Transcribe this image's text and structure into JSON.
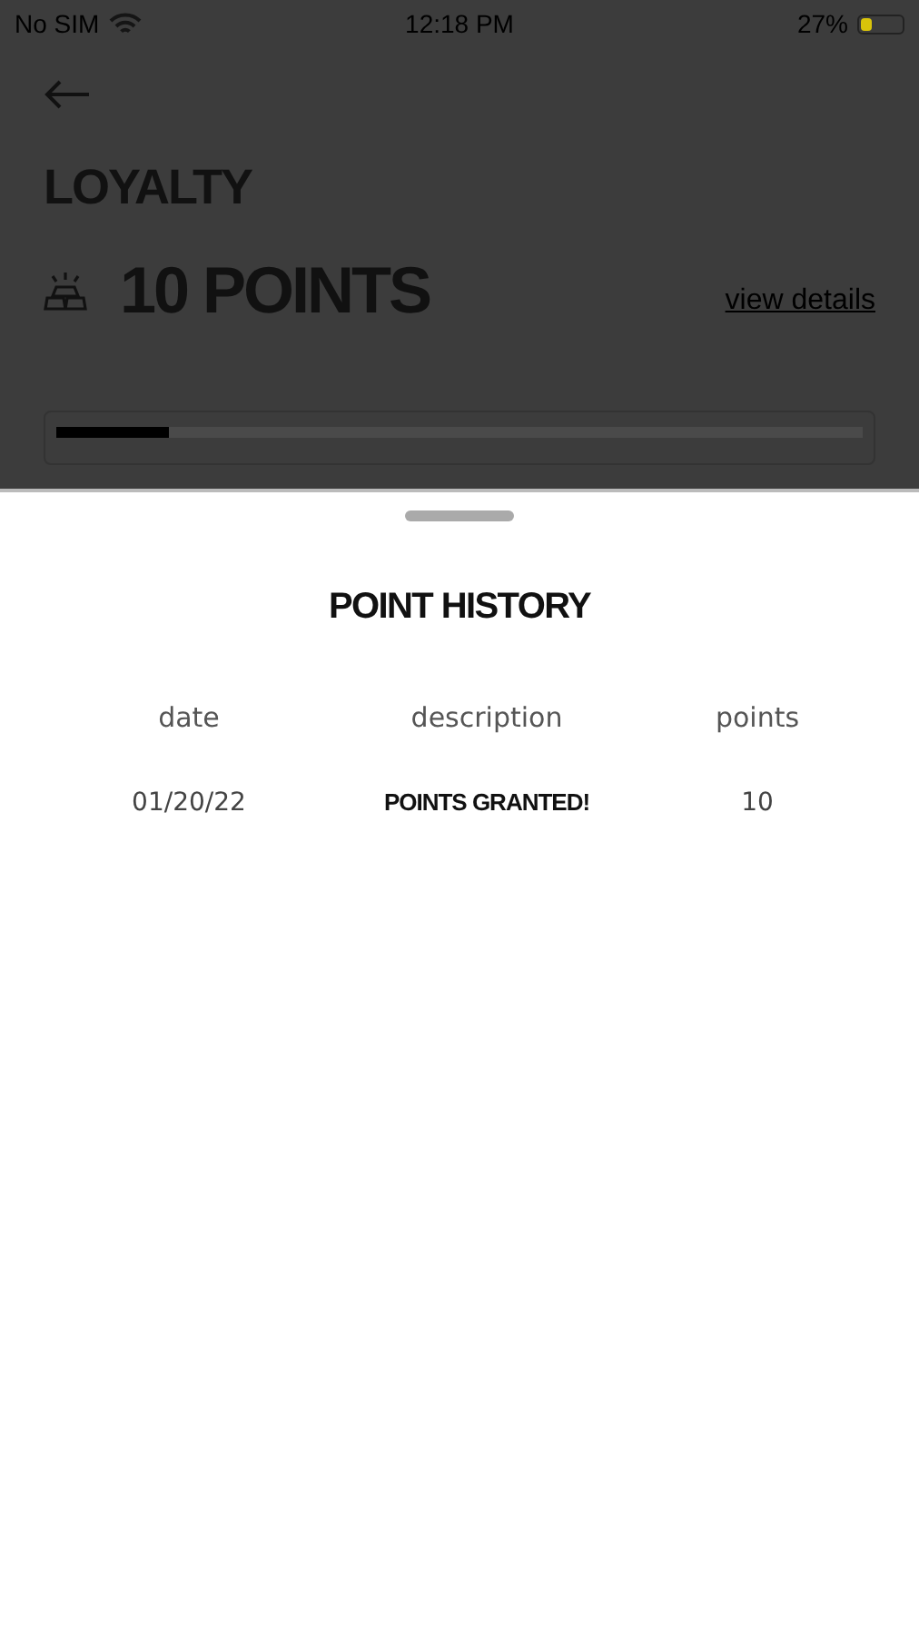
{
  "status_bar": {
    "carrier": "No SIM",
    "time": "12:18 PM",
    "battery": "27%"
  },
  "background": {
    "title": "LOYALTY",
    "points": "10 POINTS",
    "link": "view details",
    "progress": {
      "level": 0.14
    }
  },
  "sheet": {
    "title": "POINT HISTORY",
    "columns": [
      "date",
      "description",
      "points"
    ],
    "rows": [
      {
        "date": "01/20/22",
        "description": "POINTS GRANTED!",
        "points": "10"
      }
    ]
  }
}
